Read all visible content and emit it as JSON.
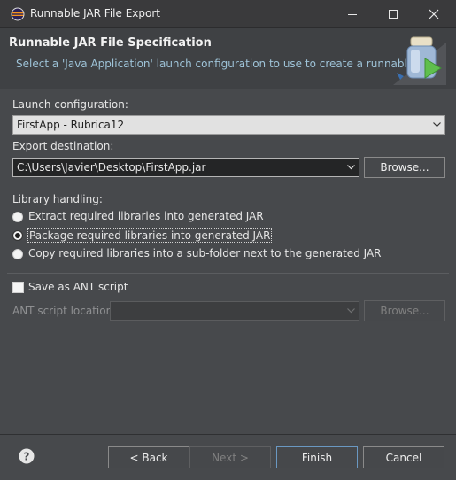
{
  "window": {
    "title": "Runnable JAR File Export"
  },
  "header": {
    "title": "Runnable JAR File Specification",
    "description": "Select a 'Java Application' launch configuration to use to create a runnable JAR."
  },
  "launch": {
    "label": "Launch configuration:",
    "value": "FirstApp - Rubrica12"
  },
  "export": {
    "label": "Export destination:",
    "value": "C:\\Users\\Javier\\Desktop\\FirstApp.jar",
    "browse_label": "Browse..."
  },
  "library": {
    "label": "Library handling:",
    "options": [
      {
        "label": "Extract required libraries into generated JAR",
        "checked": false
      },
      {
        "label": "Package required libraries into generated JAR",
        "checked": true
      },
      {
        "label": "Copy required libraries into a sub-folder next to the generated JAR",
        "checked": false
      }
    ]
  },
  "ant": {
    "save_label": "Save as ANT script",
    "save_checked": false,
    "location_label": "ANT script location:",
    "location_value": "",
    "browse_label": "Browse..."
  },
  "footer": {
    "back_label": "< Back",
    "next_label": "Next >",
    "finish_label": "Finish",
    "cancel_label": "Cancel"
  }
}
